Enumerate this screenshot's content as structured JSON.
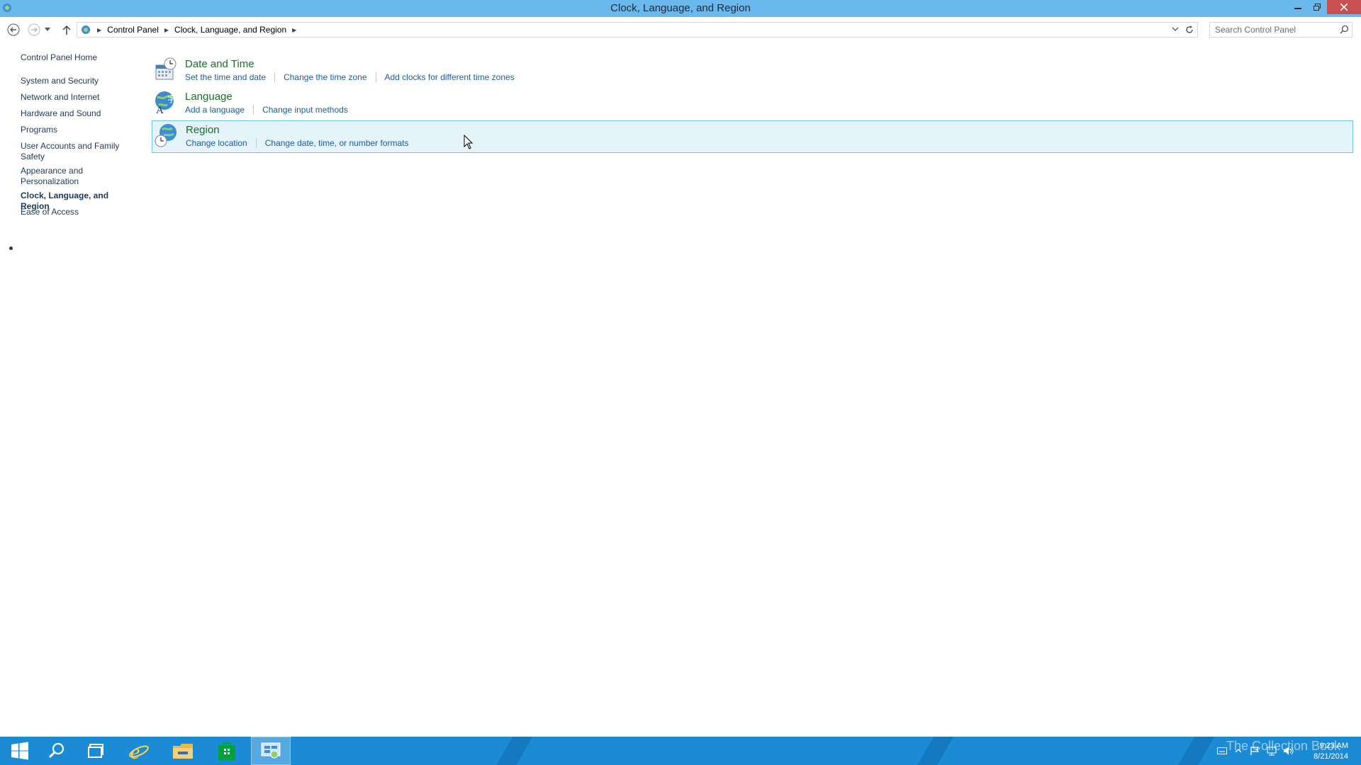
{
  "window": {
    "title": "Clock, Language, and Region"
  },
  "address": {
    "crumbs": [
      "Control Panel",
      "Clock, Language, and Region"
    ],
    "search_placeholder": "Search Control Panel"
  },
  "sidebar": {
    "home": "Control Panel Home",
    "items": [
      {
        "label": "System and Security"
      },
      {
        "label": "Network and Internet"
      },
      {
        "label": "Hardware and Sound"
      },
      {
        "label": "Programs"
      },
      {
        "label": "User Accounts and Family Safety"
      },
      {
        "label": "Appearance and Personalization"
      },
      {
        "label": "Clock, Language, and Region"
      },
      {
        "label": "Ease of Access"
      }
    ]
  },
  "categories": [
    {
      "title": "Date and Time",
      "icon": "date-time-icon",
      "links": [
        "Set the time and date",
        "Change the time zone",
        "Add clocks for different time zones"
      ]
    },
    {
      "title": "Language",
      "icon": "language-icon",
      "links": [
        "Add a language",
        "Change input methods"
      ]
    },
    {
      "title": "Region",
      "icon": "region-globe-icon",
      "links": [
        "Change location",
        "Change date, time, or number formats"
      ]
    }
  ],
  "taskbar": {
    "time": "9:23 AM",
    "date": "8/21/2014",
    "watermark": "The Collection Book"
  },
  "colors": {
    "titlebar": "#6ab8ec",
    "taskbar": "#1c8bd6",
    "link": "#1a5ea8",
    "category_title": "#1a6e2c",
    "hover_bg": "#e5f3fb"
  }
}
